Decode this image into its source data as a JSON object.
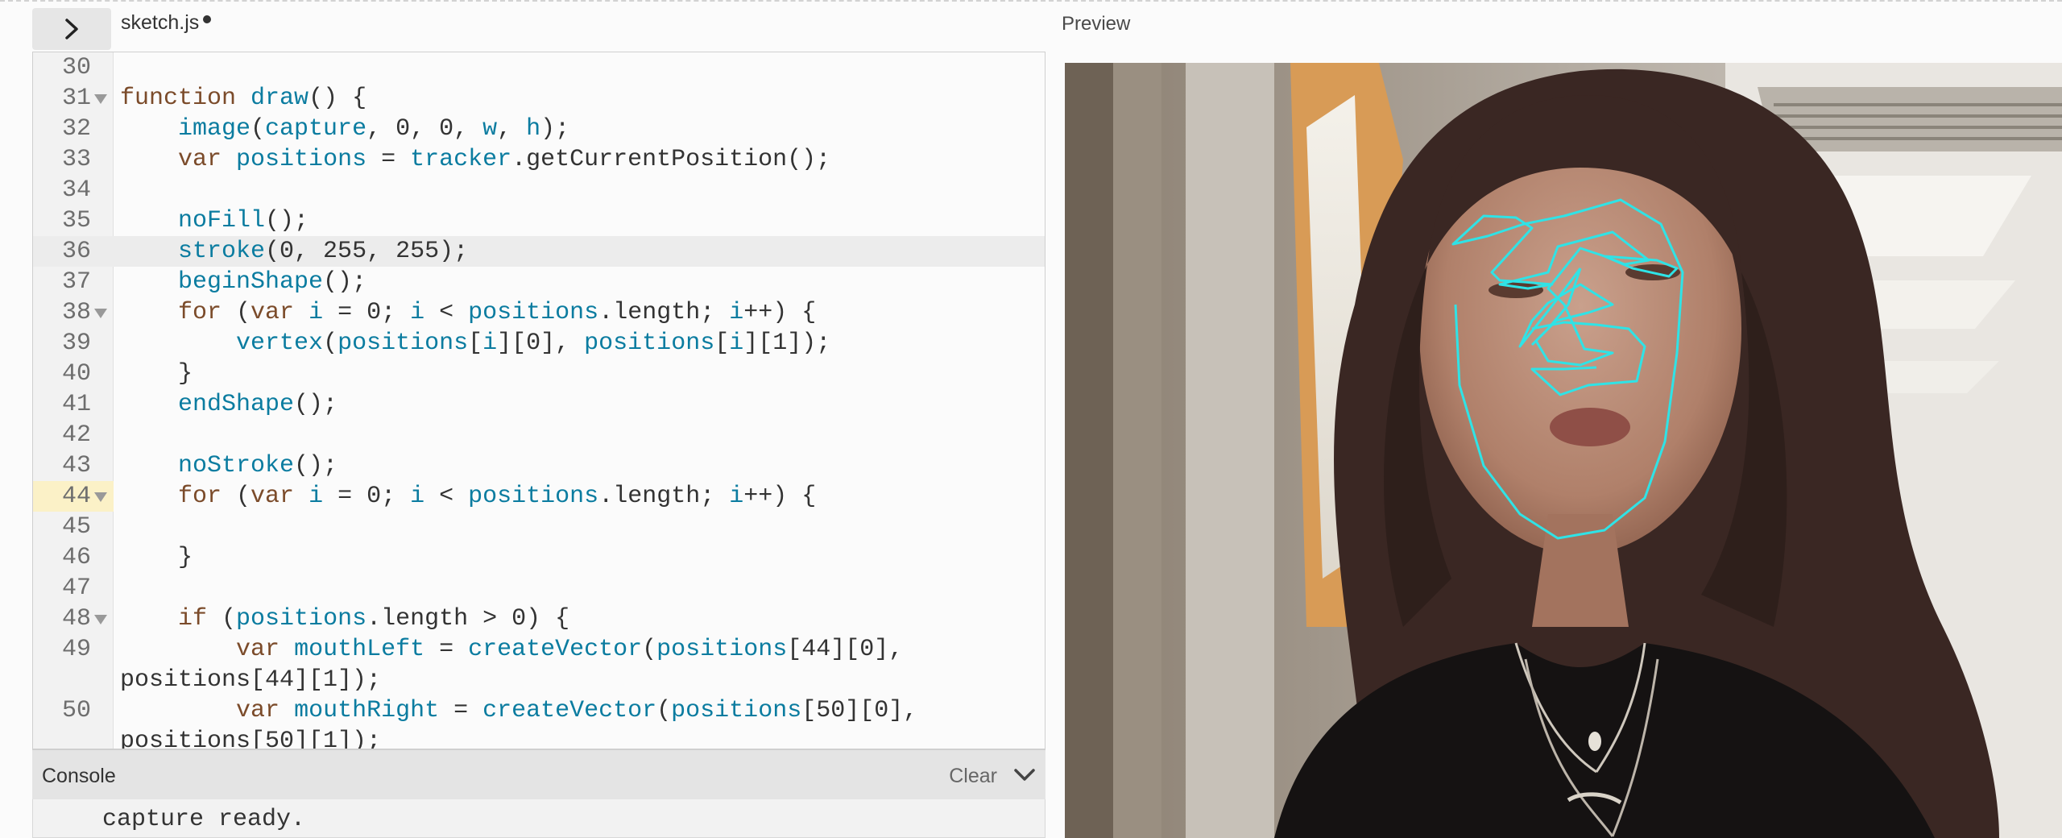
{
  "tab": {
    "filename": "sketch.js",
    "unsaved": true
  },
  "preview": {
    "label": "Preview",
    "overlay_color": "#2fe3e6"
  },
  "editor": {
    "lines": [
      {
        "n": "30",
        "code": ""
      },
      {
        "n": "31",
        "code": "function draw() {",
        "fold": true
      },
      {
        "n": "32",
        "code": "    image(capture, 0, 0, w, h);"
      },
      {
        "n": "33",
        "code": "    var positions = tracker.getCurrentPosition();"
      },
      {
        "n": "34",
        "code": ""
      },
      {
        "n": "35",
        "code": "    noFill();"
      },
      {
        "n": "36",
        "code": "    stroke(0, 255, 255);",
        "highlight": true
      },
      {
        "n": "37",
        "code": "    beginShape();"
      },
      {
        "n": "38",
        "code": "    for (var i = 0; i < positions.length; i++) {",
        "fold": true
      },
      {
        "n": "39",
        "code": "        vertex(positions[i][0], positions[i][1]);"
      },
      {
        "n": "40",
        "code": "    }"
      },
      {
        "n": "41",
        "code": "    endShape();"
      },
      {
        "n": "42",
        "code": ""
      },
      {
        "n": "43",
        "code": "    noStroke();"
      },
      {
        "n": "44",
        "code": "    for (var i = 0; i < positions.length; i++) {",
        "fold": true,
        "marked": true
      },
      {
        "n": "45",
        "code": ""
      },
      {
        "n": "46",
        "code": "    }"
      },
      {
        "n": "47",
        "code": ""
      },
      {
        "n": "48",
        "code": "    if (positions.length > 0) {",
        "fold": true
      },
      {
        "n": "49",
        "code": "        var mouthLeft = createVector(positions[44][0],",
        "wrap": "positions[44][1]);"
      },
      {
        "n": "50",
        "code": "        var mouthRight = createVector(positions[50][0],",
        "wrap": "positions[50][1]);"
      }
    ]
  },
  "console": {
    "title": "Console",
    "clear_label": "Clear",
    "messages": [
      "capture ready."
    ]
  }
}
